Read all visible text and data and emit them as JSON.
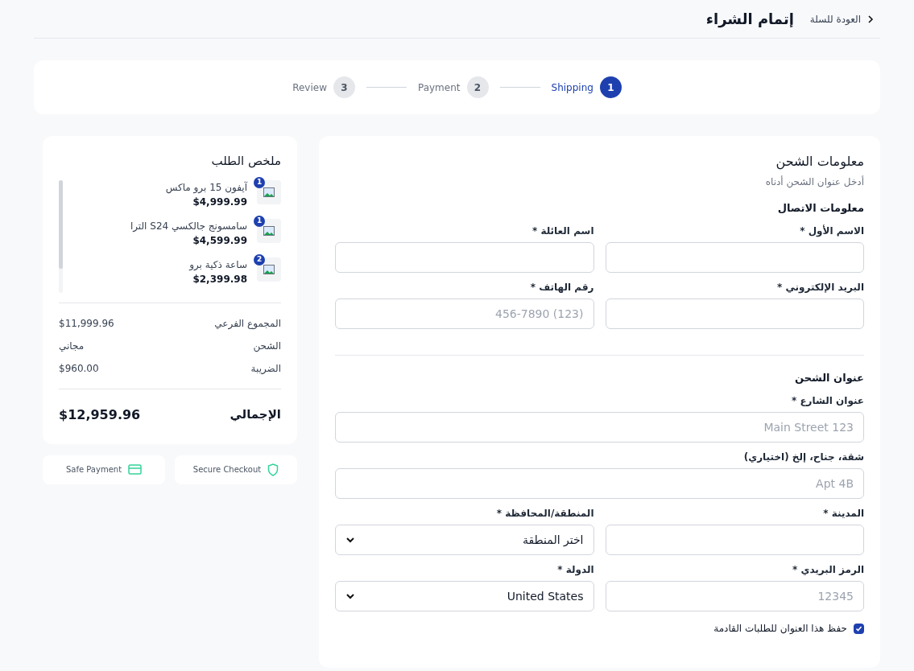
{
  "header": {
    "title": "إتمام الشراء",
    "back_link": "العودة للسلة"
  },
  "steps": [
    {
      "number": "1",
      "label": "Shipping",
      "selected": true
    },
    {
      "number": "2",
      "label": "Payment",
      "selected": false
    },
    {
      "number": "3",
      "label": "Review",
      "selected": false
    }
  ],
  "shipping_form": {
    "title": "معلومات الشحن",
    "subtitle": "أدخل عنوان الشحن أدناه",
    "sections": [
      {
        "title": "معلومات الاتصال",
        "rows": [
          [
            {
              "kind": "input",
              "label": "الاسم الأول *"
            },
            {
              "kind": "input",
              "label": "اسم العائلة *"
            }
          ],
          [
            {
              "kind": "input",
              "label": "البريد الإلكتروني *"
            },
            {
              "kind": "input",
              "label": "رقم الهاتف *",
              "placeholder": "(123) 456-7890"
            }
          ]
        ]
      },
      {
        "title": "عنوان الشحن",
        "rows": [
          [
            {
              "kind": "input",
              "label": "عنوان الشارع *",
              "placeholder": "Main Street 123"
            }
          ],
          [
            {
              "kind": "input",
              "label": "شقة، جناح، إلخ (اختياري)",
              "placeholder": "Apt 4B"
            }
          ],
          [
            {
              "kind": "input",
              "label": "المدينة *"
            },
            {
              "kind": "select",
              "label": "المنطقة/المحافظة *",
              "value": "اختر المنطقة"
            }
          ],
          [
            {
              "kind": "input",
              "label": "الرمز البريدي *",
              "placeholder": "12345"
            },
            {
              "kind": "select",
              "label": "الدولة *",
              "value": "United States"
            }
          ]
        ]
      }
    ],
    "save_address": {
      "label": "حفظ هذا العنوان للطلبات القادمة",
      "checked": true
    }
  },
  "order_summary": {
    "title": "ملخص الطلب",
    "items": [
      {
        "name": "آيفون 15 برو ماكس",
        "price": "$4,999.99",
        "quantity": "1"
      },
      {
        "name": "سامسونج جالكسي S24 الترا",
        "price": "$4,599.99",
        "quantity": "1"
      },
      {
        "name": "ساعة ذكية برو",
        "price": "$2,399.98",
        "quantity": "2"
      }
    ],
    "lines": [
      {
        "label": "المجموع الفرعي",
        "value": "$11,999.96"
      },
      {
        "label": "الشحن",
        "value": "مجاني"
      },
      {
        "label": "الضريبة",
        "value": "$960.00"
      }
    ],
    "total": {
      "label": "الإجمالي",
      "value": "$12,959.96"
    }
  },
  "badges": [
    {
      "kind": "shield",
      "label": "Secure Checkout"
    },
    {
      "kind": "card",
      "label": "Safe Payment"
    }
  ]
}
